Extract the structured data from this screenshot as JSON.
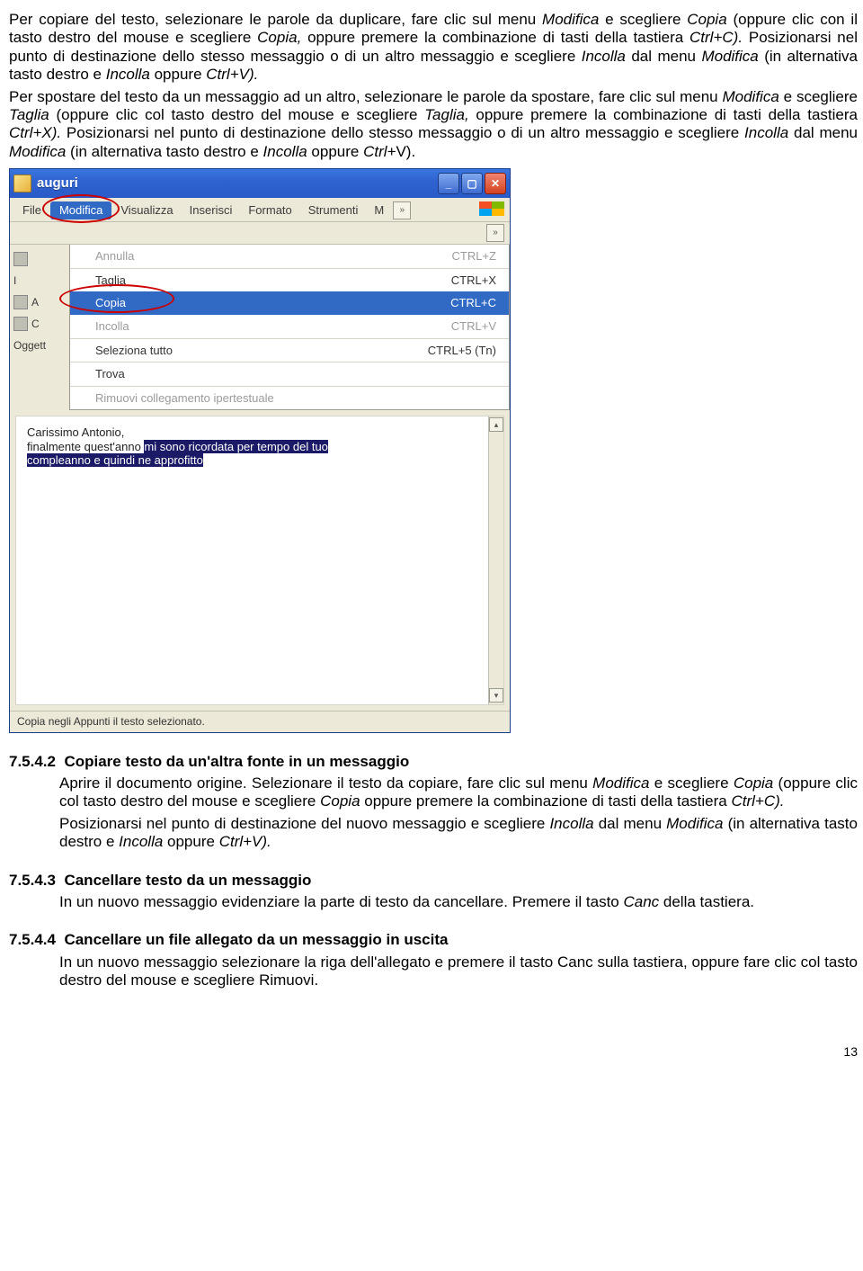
{
  "para1": {
    "l1a": "Per copiare del testo, selezionare le parole da duplicare, fare clic sul menu ",
    "l1b": "Modifica",
    "l1c": " e scegliere ",
    "l2a": "Copia",
    "l2b": " (oppure clic con il tasto destro del mouse e scegliere ",
    "l2c": "Copia,",
    "l2d": " oppure premere la combinazione di tasti della tastiera ",
    "l2e": "Ctrl+C).",
    "l2f": " Posizionarsi nel punto di destinazione dello stesso messaggio o di un altro messaggio e scegliere ",
    "l2g": "Incolla",
    "l2h": " dal menu ",
    "l2i": "Modifica",
    "l2j": " (in alternativa tasto destro e ",
    "l2k": "Incolla",
    "l2l": " oppure ",
    "l2m": "Ctrl+V)."
  },
  "para2": {
    "a": "Per spostare del testo da un messaggio ad un altro, selezionare le parole da spostare, fare clic sul menu ",
    "b": "Modifica",
    "c": " e scegliere ",
    "d": "Taglia",
    "e": " (oppure clic col tasto destro del mouse e scegliere ",
    "f": "Taglia,",
    "g": " oppure premere la combinazione di tasti della tastiera ",
    "h": "Ctrl+X).",
    "i": " Posizionarsi nel punto di destinazione dello stesso messaggio o di un altro messaggio e scegliere ",
    "j": "Incolla",
    "k": " dal menu ",
    "l": "Modifica",
    "m": " (in alternativa tasto destro e ",
    "n": "Incolla",
    "o": " oppure ",
    "p": "Ctrl+",
    "q": "V)."
  },
  "win": {
    "title": "auguri",
    "menus": {
      "file": "File",
      "modifica": "Modifica",
      "visualizza": "Visualizza",
      "inserisci": "Inserisci",
      "formato": "Formato",
      "strumenti": "Strumenti",
      "more": "M"
    },
    "left": {
      "i": "I",
      "a": "A",
      "c": "C",
      "ogg": "Oggett"
    },
    "menu": {
      "annulla": {
        "label": "Annulla",
        "short": "CTRL+Z"
      },
      "taglia": {
        "label": "Taglia",
        "short": "CTRL+X"
      },
      "copia": {
        "label": "Copia",
        "short": "CTRL+C"
      },
      "incolla": {
        "label": "Incolla",
        "short": "CTRL+V"
      },
      "seltutto": {
        "label": "Seleziona tutto",
        "short": "CTRL+5 (Tn)"
      },
      "trova": {
        "label": "Trova",
        "short": ""
      },
      "rimuovi": {
        "label": "Rimuovi collegamento ipertestuale",
        "short": ""
      }
    },
    "body": {
      "l1": "Carissimo Antonio,",
      "l2a": "finalmente quest'anno ",
      "l2b": "mi sono ricordata per tempo del tuo",
      "l3": "compleanno e quindi ne approfitto"
    },
    "status": "Copia negli Appunti il testo selezionato."
  },
  "sec7542": {
    "num": "7.5.4.2",
    "title": "Copiare testo da un'altra fonte in un messaggio",
    "t1": "Aprire il documento origine. Selezionare il testo da copiare, fare clic sul menu ",
    "t2": "Modifica",
    "t3": " e scegliere ",
    "t4": "Copia",
    "t5": " (oppure clic col tasto destro del mouse e scegliere ",
    "t6": "Copia",
    "t7": " oppure premere la combinazione di tasti della tastiera ",
    "t8": "Ctrl+C).",
    "p2a": "Posizionarsi nel punto di destinazione del nuovo messaggio e scegliere ",
    "p2b": "Incolla",
    "p2c": " dal menu ",
    "p2d": "Modifica",
    "p2e": " (in alternativa tasto destro e ",
    "p2f": "Incolla",
    "p2g": " oppure ",
    "p2h": "Ctrl+V)."
  },
  "sec7543": {
    "num": "7.5.4.3",
    "title": "Cancellare testo da un messaggio",
    "t1": "In un nuovo messaggio evidenziare la parte di testo da cancellare. Premere il tasto ",
    "t2": "Canc",
    "t3": " della tastiera."
  },
  "sec7544": {
    "num": "7.5.4.4",
    "title": "Cancellare un file allegato da un messaggio in uscita",
    "t1": "In un nuovo messaggio selezionare la riga dell'allegato e premere il tasto Canc sulla tastiera, oppure fare clic col tasto destro del mouse e scegliere Rimuovi."
  },
  "page": "13"
}
